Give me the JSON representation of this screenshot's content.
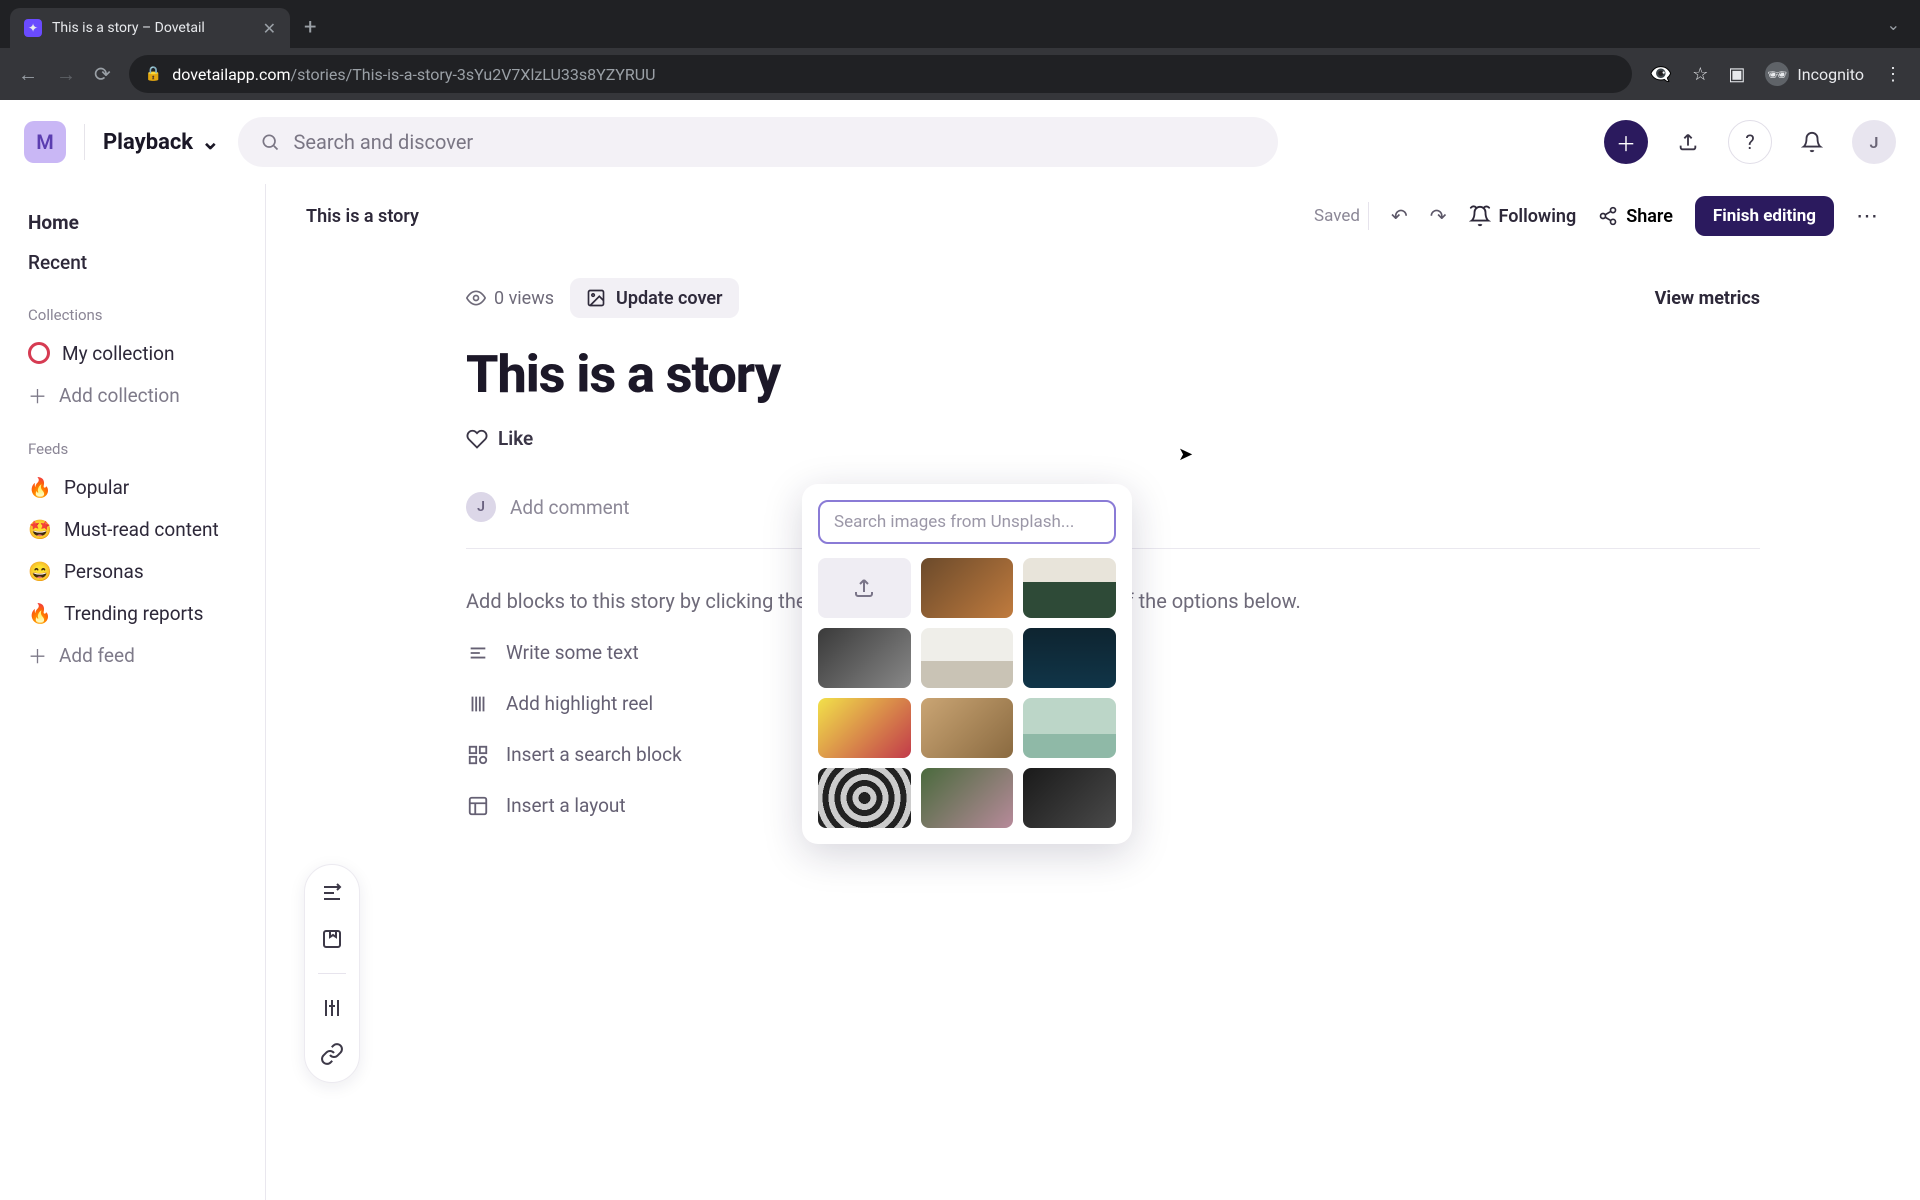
{
  "browser": {
    "tab_title": "This is a story – Dovetail",
    "url_host": "dovetailapp.com",
    "url_path": "/stories/This-is-a-story-3sYu2V7XlzLU33s8YZYRUU",
    "incognito_label": "Incognito"
  },
  "header": {
    "workspace_initial": "M",
    "workspace_name": "Playback",
    "search_placeholder": "Search and discover",
    "avatar_initial": "J"
  },
  "sidebar": {
    "home": "Home",
    "recent": "Recent",
    "collections_label": "Collections",
    "my_collection": "My collection",
    "add_collection": "Add collection",
    "feeds_label": "Feeds",
    "feeds": [
      {
        "emoji": "🔥",
        "label": "Popular"
      },
      {
        "emoji": "🤩",
        "label": "Must-read content"
      },
      {
        "emoji": "😄",
        "label": "Personas"
      },
      {
        "emoji": "🔥",
        "label": "Trending reports"
      }
    ],
    "add_feed": "Add feed"
  },
  "docbar": {
    "title": "This is a story",
    "saved": "Saved",
    "following": "Following",
    "share": "Share",
    "finish": "Finish editing"
  },
  "content": {
    "views": "0 views",
    "update_cover": "Update cover",
    "view_metrics": "View metrics",
    "title": "This is a story",
    "like": "Like",
    "comment_placeholder": "Add comment",
    "comment_avatar": "J",
    "hint_full": "Add blocks to this story by clicking the + button to the left, or choose one of the options below.",
    "hint_suffix": "the left, or choose one of the options below.",
    "options": {
      "write": "Write some text",
      "highlight": "Add highlight reel",
      "search": "Insert a search block",
      "layout": "Insert a layout"
    }
  },
  "popover": {
    "search_placeholder": "Search images from Unsplash..."
  }
}
